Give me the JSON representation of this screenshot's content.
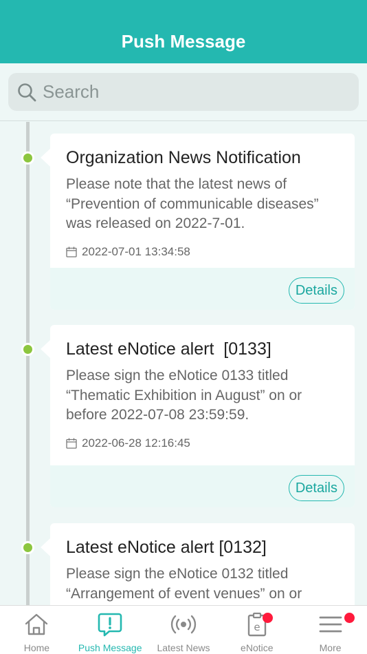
{
  "header": {
    "title": "Push Message"
  },
  "search": {
    "placeholder": "Search",
    "value": ""
  },
  "messages": [
    {
      "title": "Organization News Notification",
      "body": "Please note that the latest news of “Prevention of communicable diseases” was released on 2022-7-01.",
      "date": "2022-07-01 13:34:58",
      "action": "Details"
    },
    {
      "title": "Latest eNotice alert  [0133]",
      "body": "Please sign the eNotice 0133 titled “Thematic Exhibition in August” on or before 2022-07-08 23:59:59.",
      "date": "2022-06-28 12:16:45",
      "action": "Details"
    },
    {
      "title": "Latest eNotice alert [0132]",
      "body": "Please sign the eNotice 0132 titled “Arrangement of event venues” on or",
      "date": "",
      "action": ""
    }
  ],
  "tabs": [
    {
      "label": "Home",
      "icon": "home-icon",
      "active": false,
      "badge": false
    },
    {
      "label": "Push Message",
      "icon": "message-alert-icon",
      "active": true,
      "badge": false
    },
    {
      "label": "Latest News",
      "icon": "broadcast-icon",
      "active": false,
      "badge": false
    },
    {
      "label": "eNotice",
      "icon": "enotice-icon",
      "active": false,
      "badge": true
    },
    {
      "label": "More",
      "icon": "menu-icon",
      "active": false,
      "badge": true
    }
  ],
  "colors": {
    "primary": "#24b8b0",
    "timeline_dot": "#8cc63f",
    "badge": "#ff1a3c",
    "background": "#eef7f6"
  }
}
